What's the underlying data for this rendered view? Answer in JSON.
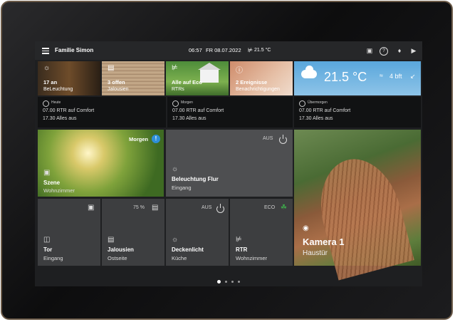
{
  "header": {
    "title": "Familie Simon",
    "time": "06:57",
    "date": "FR 08.07.2022",
    "temperature": "21.5 °C",
    "icons": [
      "lock-icon",
      "help-icon",
      "bell-icon",
      "speaker-icon"
    ]
  },
  "status_tiles": [
    {
      "line1": "17 an",
      "line2": "BeLeuchtung",
      "icon": "bulb-icon"
    },
    {
      "line1": "3 offen",
      "line2": "Jalousien",
      "icon": "blind-icon"
    },
    {
      "line1": "Alle auf Eco",
      "line2": "RTRs",
      "icon": "thermometer-icon"
    },
    {
      "line1": "2 Ereignisse",
      "line2": "Benachrichtigungen",
      "icon": "info-icon"
    }
  ],
  "weather": {
    "temperature": "21.5 °C",
    "wind": "4 bft",
    "icon": "cloud-sun-icon"
  },
  "schedule": [
    {
      "day": "Heute",
      "entry1": "07.00 RTR auf Comfort",
      "entry2": "17.30 Alles aus"
    },
    {
      "day": "Morgen",
      "entry1": "07.00 RTR auf Comfort",
      "entry2": "17.30 Alles aus"
    },
    {
      "day": "Übermorgen",
      "entry1": "07.00 RTR auf Comfort",
      "entry2": "17.30 Alles aus"
    }
  ],
  "tiles": {
    "scene": {
      "state": "Morgen",
      "name": "Szene",
      "sub": "Wohnzimmer"
    },
    "flur": {
      "state": "AUS",
      "name": "Beleuchtung Flur",
      "sub": "Eingang"
    },
    "tor": {
      "name": "Tor",
      "sub": "Eingang"
    },
    "jalousien": {
      "state": "75 %",
      "name": "Jalousien",
      "sub": "Ostseite"
    },
    "deckenlicht": {
      "state": "AUS",
      "name": "Deckenlicht",
      "sub": "Küche"
    },
    "rtr": {
      "state": "ECO",
      "name": "RTR",
      "sub": "Wohnzimmer"
    },
    "camera": {
      "name": "Kamera 1",
      "sub": "Haustür"
    }
  },
  "pagination": {
    "pages": 4,
    "active": 1
  }
}
